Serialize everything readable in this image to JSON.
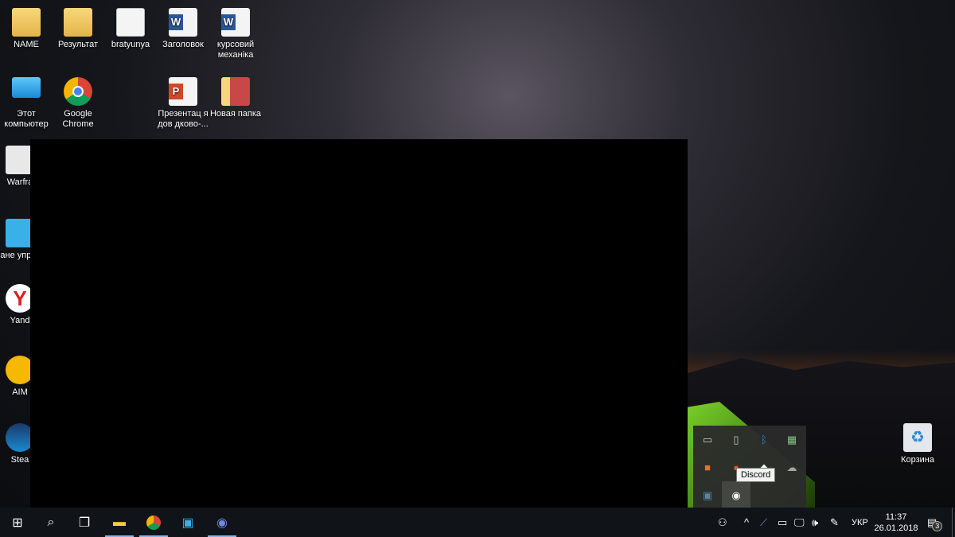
{
  "desktop": {
    "icons": [
      {
        "label": "NAME",
        "type": "folder-user"
      },
      {
        "label": "Результат",
        "type": "folder"
      },
      {
        "label": "bratyunya",
        "type": "text-doc"
      },
      {
        "label": "Заголовок",
        "type": "word-doc"
      },
      {
        "label": "курсовий механіка",
        "type": "word-doc"
      },
      {
        "label": "Этот компьютер",
        "type": "computer"
      },
      {
        "label": "Google Chrome",
        "type": "chrome"
      },
      {
        "label": "Презентац я дов дково-...",
        "type": "powerpoint"
      },
      {
        "label": "Новая папка",
        "type": "folder"
      },
      {
        "label": "Warfra",
        "type": "warframe"
      },
      {
        "label": "Пане управл",
        "type": "control-panel"
      },
      {
        "label": "Yand",
        "type": "yandex"
      },
      {
        "label": "AIM",
        "type": "aimp"
      },
      {
        "label": "Stea",
        "type": "steam"
      },
      {
        "label": "Корзина",
        "type": "recycle-bin"
      }
    ]
  },
  "tray_popup": {
    "tooltip": "Discord"
  },
  "taskbar": {
    "language": "УКР",
    "time": "11:37",
    "date": "26.01.2018",
    "notification_count": "3"
  }
}
